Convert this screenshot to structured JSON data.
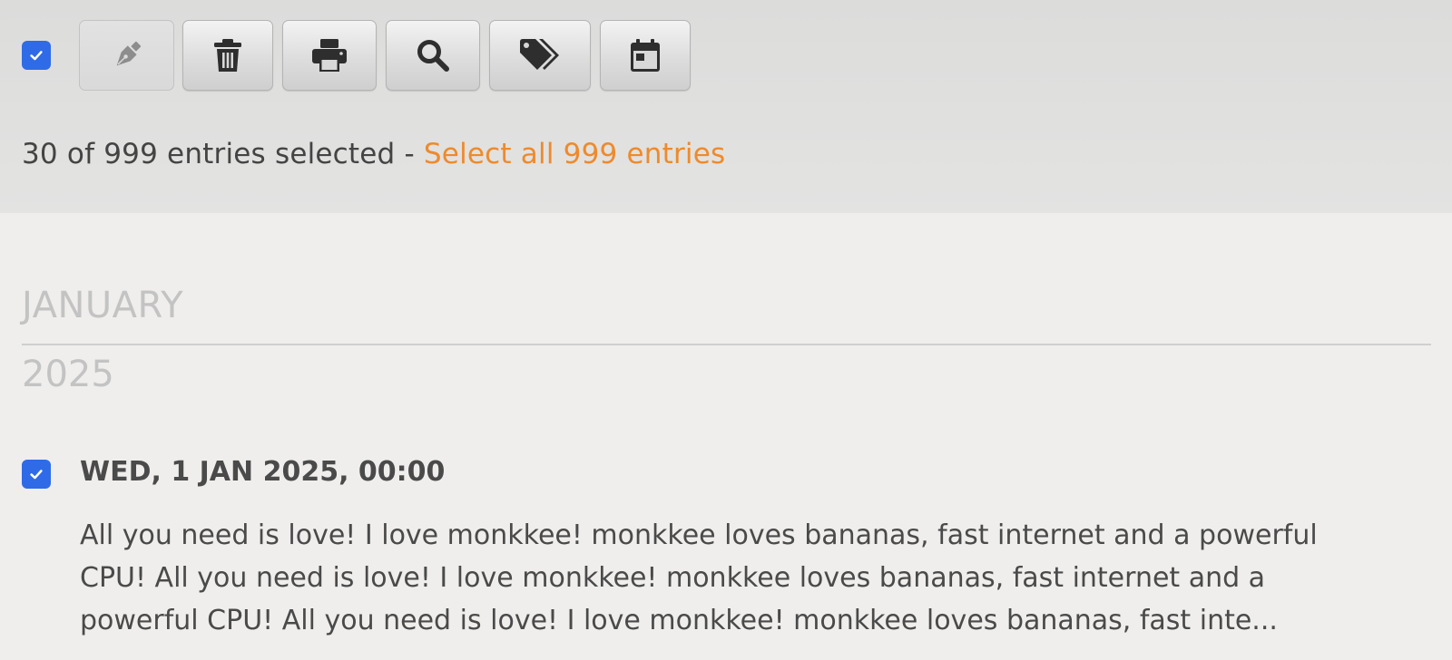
{
  "toolbar": {
    "select_checkbox_checked": true,
    "buttons": [
      {
        "icon": "pen-icon",
        "disabled": true
      },
      {
        "icon": "trash-icon",
        "disabled": false
      },
      {
        "icon": "print-icon",
        "disabled": false
      },
      {
        "icon": "search-icon",
        "disabled": false
      },
      {
        "icon": "tags-icon",
        "disabled": false
      },
      {
        "icon": "calendar-icon",
        "disabled": false
      }
    ]
  },
  "selection": {
    "summary": "30 of 999 entries selected - ",
    "select_all_link": "Select all 999 entries"
  },
  "group": {
    "month": "JANUARY",
    "year": "2025"
  },
  "entry": {
    "checked": true,
    "date": "WED, 1 JAN 2025, 00:00",
    "text": "All you need is love! I love monkkee! monkkee loves bananas, fast internet and a powerful CPU! All you need is love! I love monkkee! monkkee loves bananas, fast internet and a powerful CPU! All you need is love! I love monkkee! monkkee loves bananas, fast inte..."
  },
  "colors": {
    "accent_link": "#ee8a2c",
    "checkbox_blue": "#2f6be6",
    "muted_heading": "#c3c3c3"
  }
}
